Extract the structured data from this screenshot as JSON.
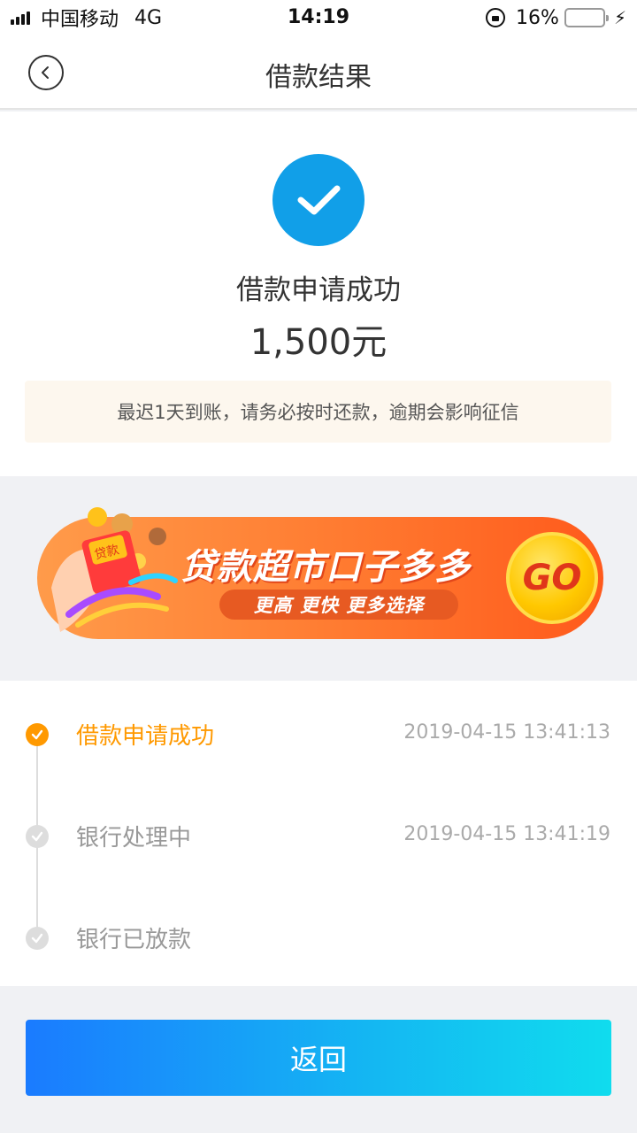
{
  "status_bar": {
    "carrier": "中国移动",
    "network": "4G",
    "time": "14:19",
    "battery": "16%",
    "battery_fraction": 0.16
  },
  "nav": {
    "title": "借款结果",
    "back_icon": "chevron-left-icon"
  },
  "result": {
    "title": "借款申请成功",
    "amount": "1,500元",
    "notice": "最迟1天到账，请务必按时还款，逾期会影响征信",
    "accent_color": "#119fe8"
  },
  "banner": {
    "title": "贷款超市口子多多",
    "subtitle": "更高  更快  更多选择",
    "go_label": "GO",
    "envelope_label": "贷款"
  },
  "timeline": {
    "items": [
      {
        "label": "借款申请成功",
        "time": "2019-04-15 13:41:13",
        "active": true
      },
      {
        "label": "银行处理中",
        "time": "2019-04-15 13:41:19",
        "active": false
      },
      {
        "label": "银行已放款",
        "time": "",
        "active": false
      }
    ],
    "active_color": "#ff9900"
  },
  "footer": {
    "return_label": "返回"
  }
}
